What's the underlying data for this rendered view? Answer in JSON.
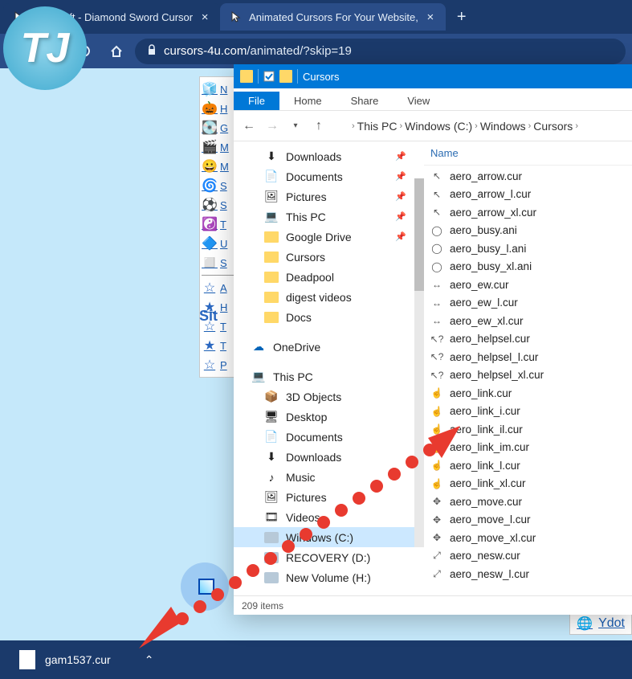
{
  "browser": {
    "tabs": [
      {
        "title": "Minecraft - Diamond Sword Cursor",
        "active": false
      },
      {
        "title": "Animated Cursors For Your Website,",
        "active": true
      }
    ],
    "url_prefix": "cursors-4u.com",
    "url_path": "/animated/?skip=19"
  },
  "sidebar_links": [
    {
      "glyph": "🧊",
      "txt": "N"
    },
    {
      "glyph": "🎃",
      "txt": "H"
    },
    {
      "glyph": "💽",
      "txt": "G"
    },
    {
      "glyph": "🎬",
      "txt": "M"
    },
    {
      "glyph": "😀",
      "txt": "M"
    },
    {
      "glyph": "🌀",
      "txt": "S"
    },
    {
      "glyph": "⚽",
      "txt": "S"
    },
    {
      "glyph": "☯️",
      "txt": "T"
    },
    {
      "glyph": "🔷",
      "txt": "U"
    },
    {
      "glyph": "◻️",
      "txt": "S"
    }
  ],
  "sidebar_stars": [
    {
      "s": "☆",
      "txt": "A"
    },
    {
      "s": "★",
      "txt": "H"
    },
    {
      "s": "☆",
      "txt": "T"
    },
    {
      "s": "★",
      "txt": "T"
    },
    {
      "s": "☆",
      "txt": "P"
    }
  ],
  "sit_label": "Sit",
  "ydot_label": "Ydot",
  "download": {
    "filename": "gam1537.cur"
  },
  "explorer": {
    "title": "Cursors",
    "ribbon_tabs": [
      "File",
      "Home",
      "Share",
      "View"
    ],
    "crumbs": [
      "This PC",
      "Windows (C:)",
      "Windows",
      "Cursors"
    ],
    "quick_access": [
      {
        "label": "Downloads",
        "icon": "⬇",
        "pin": true
      },
      {
        "label": "Documents",
        "icon": "📄",
        "pin": true
      },
      {
        "label": "Pictures",
        "icon": "🖼",
        "pin": true
      },
      {
        "label": "This PC",
        "icon": "💻",
        "pin": true
      },
      {
        "label": "Google Drive",
        "icon": "folder",
        "pin": true
      },
      {
        "label": "Cursors",
        "icon": "folder",
        "pin": false
      },
      {
        "label": "Deadpool",
        "icon": "folder",
        "pin": false
      },
      {
        "label": "digest videos",
        "icon": "folder",
        "pin": false
      },
      {
        "label": "Docs",
        "icon": "folder",
        "pin": false
      }
    ],
    "onedrive_label": "OneDrive",
    "thispc_label": "This PC",
    "thispc_items": [
      {
        "label": "3D Objects",
        "icon": "📦"
      },
      {
        "label": "Desktop",
        "icon": "🖥"
      },
      {
        "label": "Documents",
        "icon": "📄"
      },
      {
        "label": "Downloads",
        "icon": "⬇"
      },
      {
        "label": "Music",
        "icon": "♪"
      },
      {
        "label": "Pictures",
        "icon": "🖼"
      },
      {
        "label": "Videos",
        "icon": "🎞"
      },
      {
        "label": "Windows (C:)",
        "icon": "drive",
        "selected": true
      },
      {
        "label": "RECOVERY (D:)",
        "icon": "drive"
      },
      {
        "label": "New Volume (H:)",
        "icon": "drive"
      }
    ],
    "column_name": "Name",
    "files": [
      {
        "n": "aero_arrow.cur",
        "g": "↖"
      },
      {
        "n": "aero_arrow_l.cur",
        "g": "↖"
      },
      {
        "n": "aero_arrow_xl.cur",
        "g": "↖"
      },
      {
        "n": "aero_busy.ani",
        "g": "◯"
      },
      {
        "n": "aero_busy_l.ani",
        "g": "◯"
      },
      {
        "n": "aero_busy_xl.ani",
        "g": "◯"
      },
      {
        "n": "aero_ew.cur",
        "g": "↔"
      },
      {
        "n": "aero_ew_l.cur",
        "g": "↔"
      },
      {
        "n": "aero_ew_xl.cur",
        "g": "↔"
      },
      {
        "n": "aero_helpsel.cur",
        "g": "↖?"
      },
      {
        "n": "aero_helpsel_l.cur",
        "g": "↖?"
      },
      {
        "n": "aero_helpsel_xl.cur",
        "g": "↖?"
      },
      {
        "n": "aero_link.cur",
        "g": "☝"
      },
      {
        "n": "aero_link_i.cur",
        "g": "☝"
      },
      {
        "n": "aero_link_il.cur",
        "g": "☝"
      },
      {
        "n": "aero_link_im.cur",
        "g": "☝"
      },
      {
        "n": "aero_link_l.cur",
        "g": "☝"
      },
      {
        "n": "aero_link_xl.cur",
        "g": "☝"
      },
      {
        "n": "aero_move.cur",
        "g": "✥"
      },
      {
        "n": "aero_move_l.cur",
        "g": "✥"
      },
      {
        "n": "aero_move_xl.cur",
        "g": "✥"
      },
      {
        "n": "aero_nesw.cur",
        "g": "⤢"
      },
      {
        "n": "aero_nesw_l.cur",
        "g": "⤢"
      }
    ],
    "status": "209 items"
  }
}
